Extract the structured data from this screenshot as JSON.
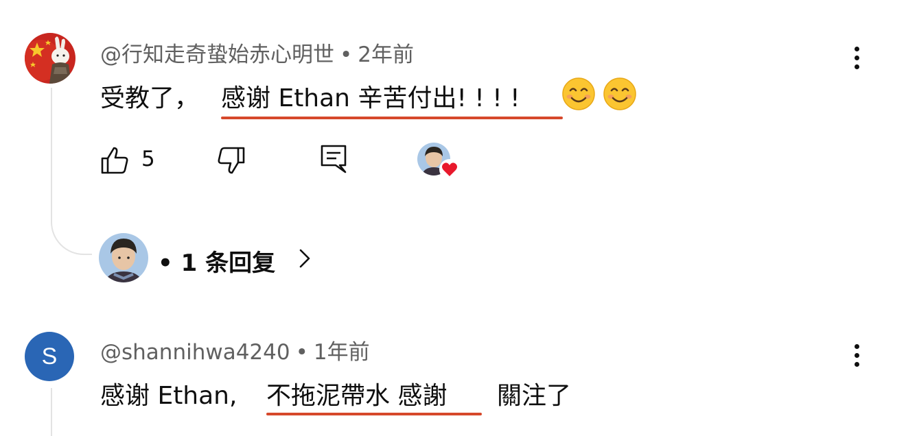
{
  "comments": [
    {
      "author": "@行知走奇蛰始赤心明世",
      "time": "2年前",
      "text_before": "受教了，",
      "text_highlight": "感谢 Ethan 辛苦付出! ! ! !",
      "emojis": [
        "smiling-face-emoji",
        "smiling-face-emoji"
      ],
      "likes": "5",
      "replies_label": "1 条回复"
    },
    {
      "author": "@shannihwa4240",
      "avatar_letter": "S",
      "time": "1年前",
      "text_before": "感谢 Ethan,",
      "text_highlight": "不拖泥帶水 感謝",
      "text_after": "關注了"
    }
  ],
  "separator": "•",
  "colors": {
    "underline": "#d6482b",
    "avatar_s": "#2a66b5",
    "heart": "#e8192c",
    "meta": "#606060"
  }
}
